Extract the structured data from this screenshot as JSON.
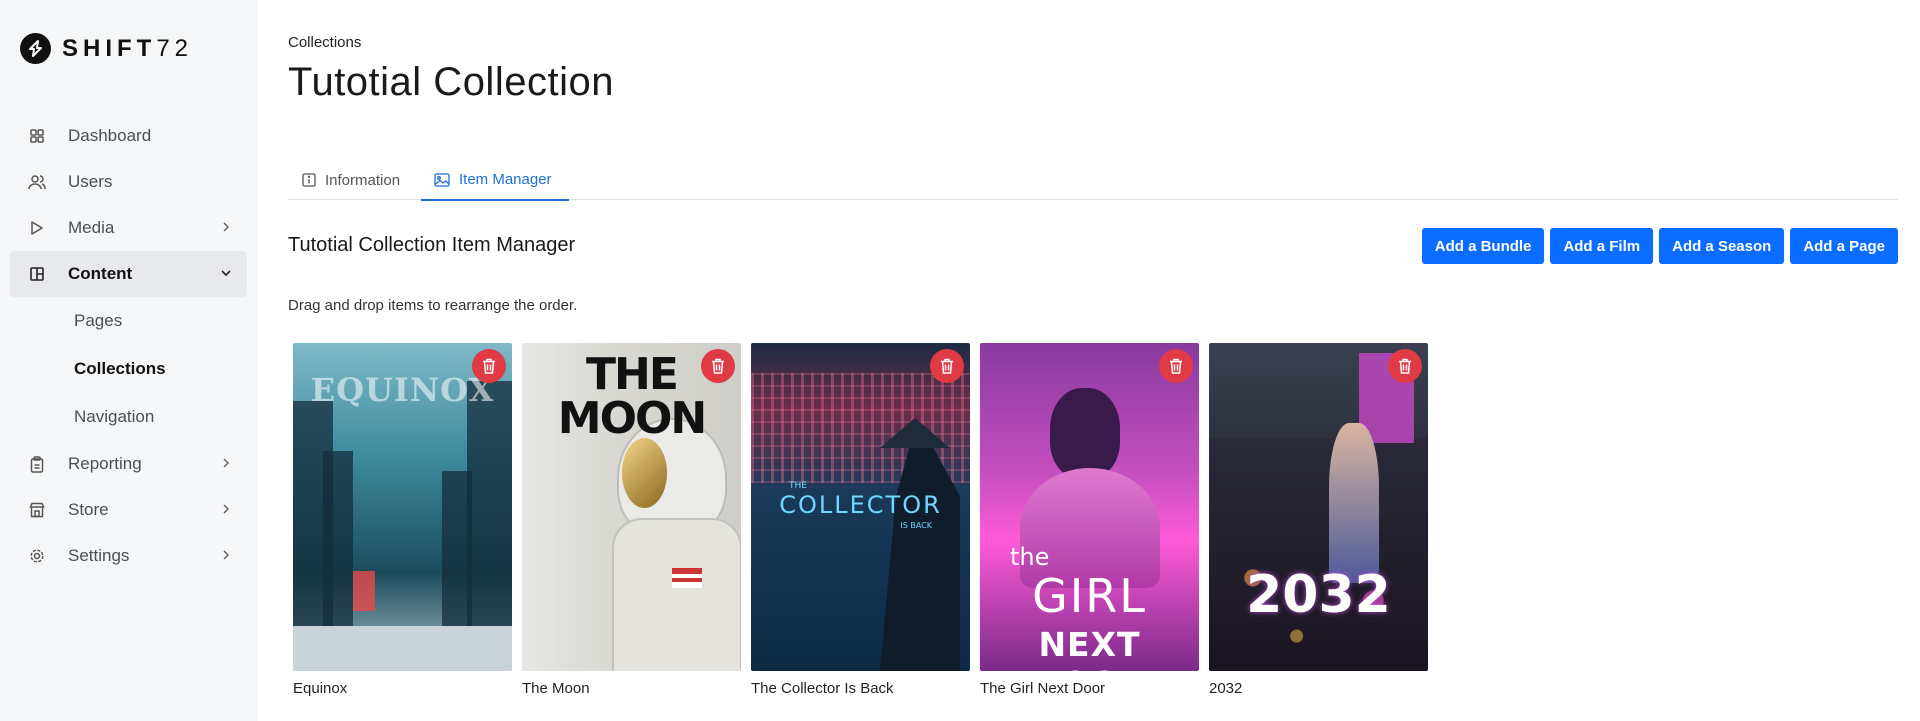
{
  "brand": {
    "name": "SHIFT",
    "number": "72"
  },
  "sidebar": {
    "items": [
      {
        "label": "Dashboard",
        "icon": "grid-icon"
      },
      {
        "label": "Users",
        "icon": "users-icon"
      },
      {
        "label": "Media",
        "icon": "play-icon"
      },
      {
        "label": "Content",
        "icon": "layout-icon"
      },
      {
        "label": "Reporting",
        "icon": "clipboard-icon"
      },
      {
        "label": "Store",
        "icon": "store-icon"
      },
      {
        "label": "Settings",
        "icon": "gear-icon"
      }
    ],
    "content_subitems": [
      {
        "label": "Pages"
      },
      {
        "label": "Collections"
      },
      {
        "label": "Navigation"
      }
    ]
  },
  "header": {
    "breadcrumb": "Collections",
    "title": "Tutotial Collection"
  },
  "tabs": [
    {
      "label": "Information",
      "icon": "info-icon"
    },
    {
      "label": "Item Manager",
      "icon": "image-icon"
    }
  ],
  "manager": {
    "title": "Tutotial Collection Item Manager",
    "hint": "Drag and drop items to rearrange the order.",
    "buttons": {
      "bundle": "Add a Bundle",
      "film": "Add a Film",
      "season": "Add a Season",
      "page": "Add a Page"
    },
    "items": [
      {
        "title": "Equinox",
        "poster_text": "EQUINOX"
      },
      {
        "title": "The Moon",
        "poster_text": "THE MOON"
      },
      {
        "title": "The Collector Is Back",
        "poster_text_top": "THE",
        "poster_text": "COLLECTOR",
        "poster_text_bottom": "IS BACK"
      },
      {
        "title": "The Girl Next Door",
        "poster_text_top": "the",
        "poster_text": "GIRL",
        "poster_text_bottom": "NEXT DOOR"
      },
      {
        "title": "2032",
        "poster_text": "2032"
      }
    ]
  },
  "colors": {
    "accent": "#0a6dff",
    "tab_active": "#1f6fd6",
    "delete": "#e03a45",
    "sidebar_bg": "#f5f6f8"
  }
}
